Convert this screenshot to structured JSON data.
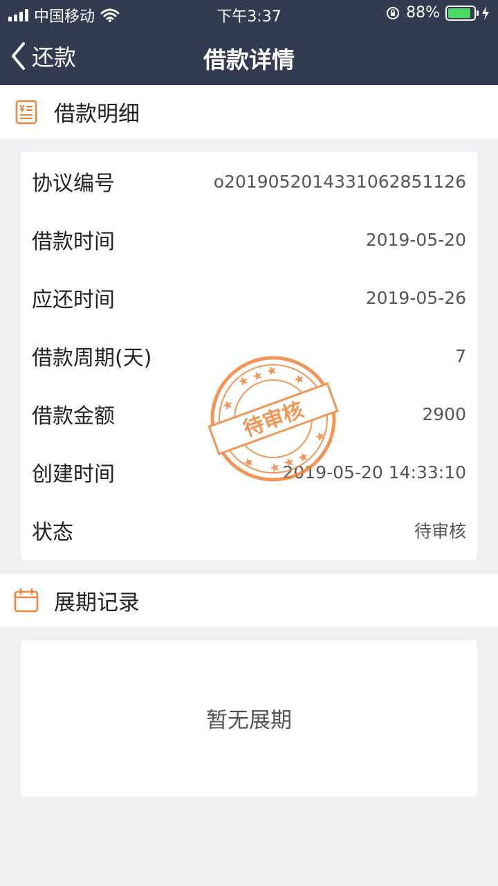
{
  "status_bar": {
    "carrier": "中国移动",
    "time": "下午3:37",
    "battery_percent": "88%",
    "battery_level": 0.88
  },
  "nav": {
    "back_label": "还款",
    "title": "借款详情"
  },
  "loan_detail": {
    "section_title": "借款明细",
    "rows": [
      {
        "label": "协议编号",
        "value": "o2019052014331062851126"
      },
      {
        "label": "借款时间",
        "value": "2019-05-20"
      },
      {
        "label": "应还时间",
        "value": "2019-05-26"
      },
      {
        "label": "借款周期(天)",
        "value": "7"
      },
      {
        "label": "借款金额",
        "value": "2900"
      },
      {
        "label": "创建时间",
        "value": "2019-05-20 14:33:10"
      },
      {
        "label": "状态",
        "value": "待审核"
      }
    ]
  },
  "stamp": {
    "text": "待审核",
    "color": "#f0833a"
  },
  "extension": {
    "section_title": "展期记录",
    "empty_text": "暂无展期"
  },
  "colors": {
    "header_bg": "#323b52",
    "accent": "#f0833a",
    "page_bg": "#efeff4"
  }
}
